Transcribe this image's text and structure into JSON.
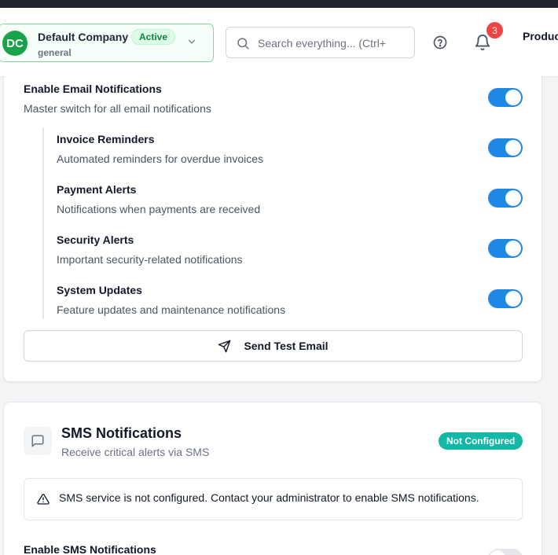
{
  "header": {
    "company": {
      "initials": "DC",
      "name": "Default Company",
      "status": "Active",
      "workspace": "general"
    },
    "search": {
      "placeholder": "Search everything... (Ctrl+"
    },
    "notifications_count": "3",
    "product_label": "Produc"
  },
  "email_section": {
    "master": {
      "title": "Enable Email Notifications",
      "description": "Master switch for all email notifications",
      "enabled": true
    },
    "items": [
      {
        "title": "Invoice Reminders",
        "description": "Automated reminders for overdue invoices",
        "enabled": true
      },
      {
        "title": "Payment Alerts",
        "description": "Notifications when payments are received",
        "enabled": true
      },
      {
        "title": "Security Alerts",
        "description": "Important security-related notifications",
        "enabled": true
      },
      {
        "title": "System Updates",
        "description": "Feature updates and maintenance notifications",
        "enabled": true
      }
    ],
    "test_button_label": "Send Test Email"
  },
  "sms_section": {
    "title": "SMS Notifications",
    "subtitle": "Receive critical alerts via SMS",
    "status_badge": "Not Configured",
    "alert_text": "SMS service is not configured. Contact your administrator to enable SMS notifications.",
    "enable_label": "Enable SMS Notifications",
    "enabled": false
  },
  "colors": {
    "accent": "#1e88e5",
    "active_green": "#16a34a",
    "warning_teal": "#14b8a6",
    "badge_red": "#ef4444"
  }
}
